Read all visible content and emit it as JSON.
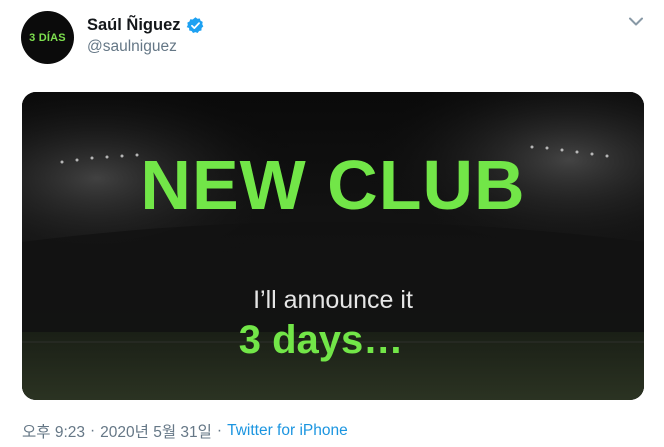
{
  "user": {
    "avatar_text": "3 DÍAS",
    "display_name": "Saúl Ñiguez",
    "handle": "@saulniguez",
    "verified": true
  },
  "media": {
    "headline": "NEW CLUB",
    "subline": "I’ll announce it",
    "days": "3 days…"
  },
  "meta": {
    "time": "오후 9:23",
    "separator": "·",
    "date": "2020년 5월 31일",
    "source": "Twitter for iPhone"
  },
  "colors": {
    "accent_green": "#72e648",
    "link_blue": "#1b95e0",
    "verified_blue": "#1da1f2",
    "secondary_text": "#657786"
  },
  "icons": {
    "verified": "verified-badge-icon",
    "menu": "chevron-down-icon"
  }
}
